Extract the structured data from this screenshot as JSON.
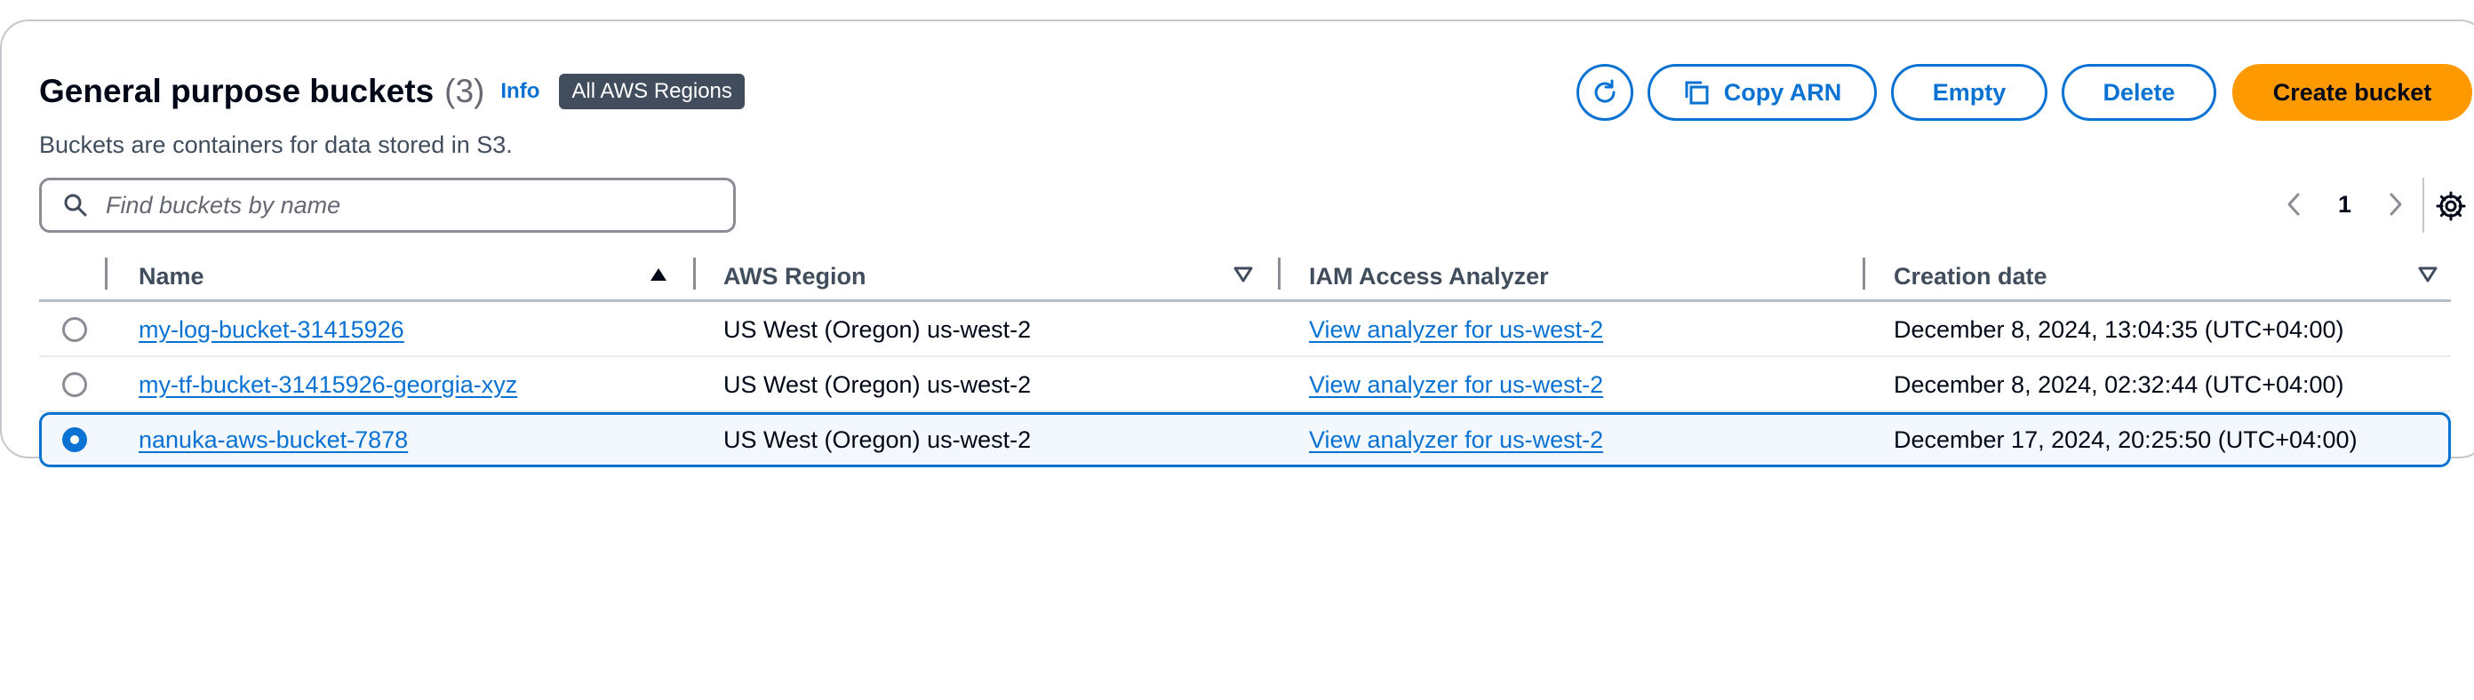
{
  "header": {
    "title": "General purpose buckets",
    "count": "(3)",
    "info_link": "Info",
    "region_badge": "All AWS Regions",
    "description": "Buckets are containers for data stored in S3."
  },
  "actions": {
    "refresh_icon": "refresh-icon",
    "copy_arn_label": "Copy ARN",
    "copy_icon": "copy-icon",
    "empty_label": "Empty",
    "delete_label": "Delete",
    "create_label": "Create bucket"
  },
  "search": {
    "placeholder": "Find buckets by name",
    "value": ""
  },
  "pagination": {
    "current_page": "1"
  },
  "table": {
    "columns": [
      "Name",
      "AWS Region",
      "IAM Access Analyzer",
      "Creation date"
    ],
    "rows": [
      {
        "name": "my-log-bucket-31415926",
        "region": "US West (Oregon) us-west-2",
        "analyzer": "View analyzer for us-west-2",
        "created": "December 8, 2024, 13:04:35 (UTC+04:00)",
        "selected": false
      },
      {
        "name": "my-tf-bucket-31415926-georgia-xyz",
        "region": "US West (Oregon) us-west-2",
        "analyzer": "View analyzer for us-west-2",
        "created": "December 8, 2024, 02:32:44 (UTC+04:00)",
        "selected": false
      },
      {
        "name": "nanuka-aws-bucket-7878",
        "region": "US West (Oregon) us-west-2",
        "analyzer": "View analyzer for us-west-2",
        "created": "December 17, 2024, 20:25:50 (UTC+04:00)",
        "selected": true
      }
    ]
  },
  "colors": {
    "accent": "#0972d3",
    "primary_button": "#ff9900",
    "badge_bg": "#414d5c",
    "selected_row_bg": "#f2f8fd"
  }
}
